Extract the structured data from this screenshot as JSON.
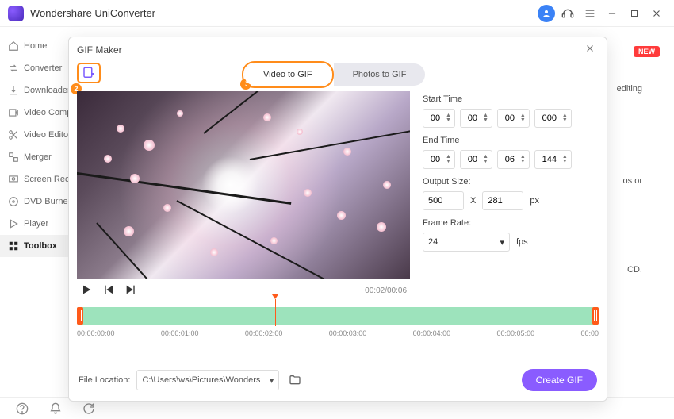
{
  "app": {
    "title": "Wondershare UniConverter"
  },
  "sidebar": {
    "items": [
      {
        "label": "Home",
        "icon": "home"
      },
      {
        "label": "Converter",
        "icon": "convert"
      },
      {
        "label": "Downloader",
        "icon": "download"
      },
      {
        "label": "Video Compressor",
        "icon": "compress"
      },
      {
        "label": "Video Editor",
        "icon": "scissors"
      },
      {
        "label": "Merger",
        "icon": "merge"
      },
      {
        "label": "Screen Recorder",
        "icon": "record"
      },
      {
        "label": "DVD Burner",
        "icon": "dvd"
      },
      {
        "label": "Player",
        "icon": "play"
      },
      {
        "label": "Toolbox",
        "icon": "grid",
        "active": true
      }
    ]
  },
  "content_bg": {
    "new_badge": "NEW",
    "hint1": "editing",
    "hint2": "os or",
    "hint3": "CD."
  },
  "markers": {
    "one": "1",
    "two": "2"
  },
  "dialog": {
    "title": "GIF Maker",
    "tabs": {
      "video": "Video to GIF",
      "photos": "Photos to GIF"
    },
    "start_label": "Start Time",
    "end_label": "End Time",
    "start": {
      "h": "00",
      "m": "00",
      "s": "00",
      "ms": "000"
    },
    "end": {
      "h": "00",
      "m": "00",
      "s": "06",
      "ms": "144"
    },
    "output_label": "Output Size:",
    "out_w": "500",
    "out_x": "X",
    "out_h": "281",
    "out_unit": "px",
    "fr_label": "Frame Rate:",
    "fr_value": "24",
    "fr_unit": "fps",
    "time_display": "00:02/00:06",
    "timeline_ticks": [
      "00:00:00:00",
      "00:00:01:00",
      "00:00:02:00",
      "00:00:03:00",
      "00:00:04:00",
      "00:00:05:00",
      "00:00"
    ],
    "floc_label": "File Location:",
    "floc_value": "C:\\Users\\ws\\Pictures\\Wonders",
    "create_label": "Create GIF"
  }
}
